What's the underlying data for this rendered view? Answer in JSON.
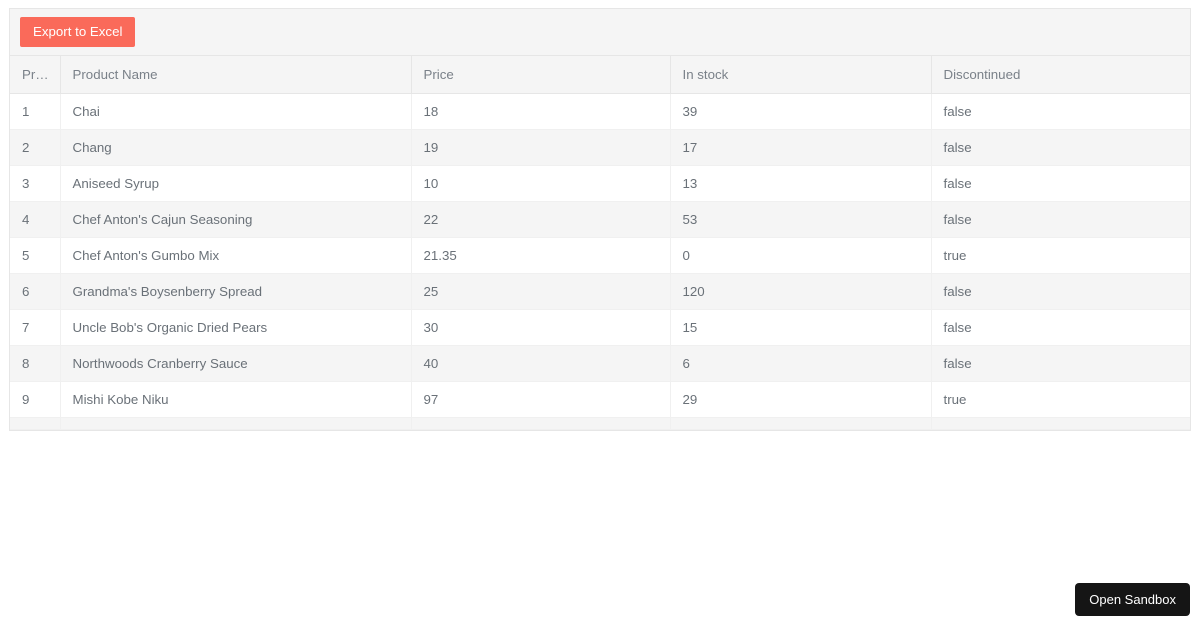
{
  "toolbar": {
    "export_label": "Export to Excel"
  },
  "grid": {
    "columns": [
      {
        "key": "id",
        "label": "Pr…"
      },
      {
        "key": "name",
        "label": "Product Name"
      },
      {
        "key": "price",
        "label": "Price"
      },
      {
        "key": "stock",
        "label": "In stock"
      },
      {
        "key": "disc",
        "label": "Discontinued"
      }
    ],
    "rows": [
      {
        "id": "1",
        "name": "Chai",
        "price": "18",
        "stock": "39",
        "disc": "false"
      },
      {
        "id": "2",
        "name": "Chang",
        "price": "19",
        "stock": "17",
        "disc": "false"
      },
      {
        "id": "3",
        "name": "Aniseed Syrup",
        "price": "10",
        "stock": "13",
        "disc": "false"
      },
      {
        "id": "4",
        "name": "Chef Anton's Cajun Seasoning",
        "price": "22",
        "stock": "53",
        "disc": "false"
      },
      {
        "id": "5",
        "name": "Chef Anton's Gumbo Mix",
        "price": "21.35",
        "stock": "0",
        "disc": "true"
      },
      {
        "id": "6",
        "name": "Grandma's Boysenberry Spread",
        "price": "25",
        "stock": "120",
        "disc": "false"
      },
      {
        "id": "7",
        "name": "Uncle Bob's Organic Dried Pears",
        "price": "30",
        "stock": "15",
        "disc": "false"
      },
      {
        "id": "8",
        "name": "Northwoods Cranberry Sauce",
        "price": "40",
        "stock": "6",
        "disc": "false"
      },
      {
        "id": "9",
        "name": "Mishi Kobe Niku",
        "price": "97",
        "stock": "29",
        "disc": "true"
      },
      {
        "id": "",
        "name": "",
        "price": "",
        "stock": "",
        "disc": ""
      }
    ]
  },
  "sandbox": {
    "label": "Open Sandbox"
  },
  "colors": {
    "accent": "#fa6a5a",
    "toolbar_bg": "#f5f5f5",
    "header_text": "#7a8189",
    "cell_text": "#6a7178",
    "alt_row_bg": "#f5f5f5",
    "border": "#e6e6e6",
    "sandbox_bg": "#151515"
  }
}
